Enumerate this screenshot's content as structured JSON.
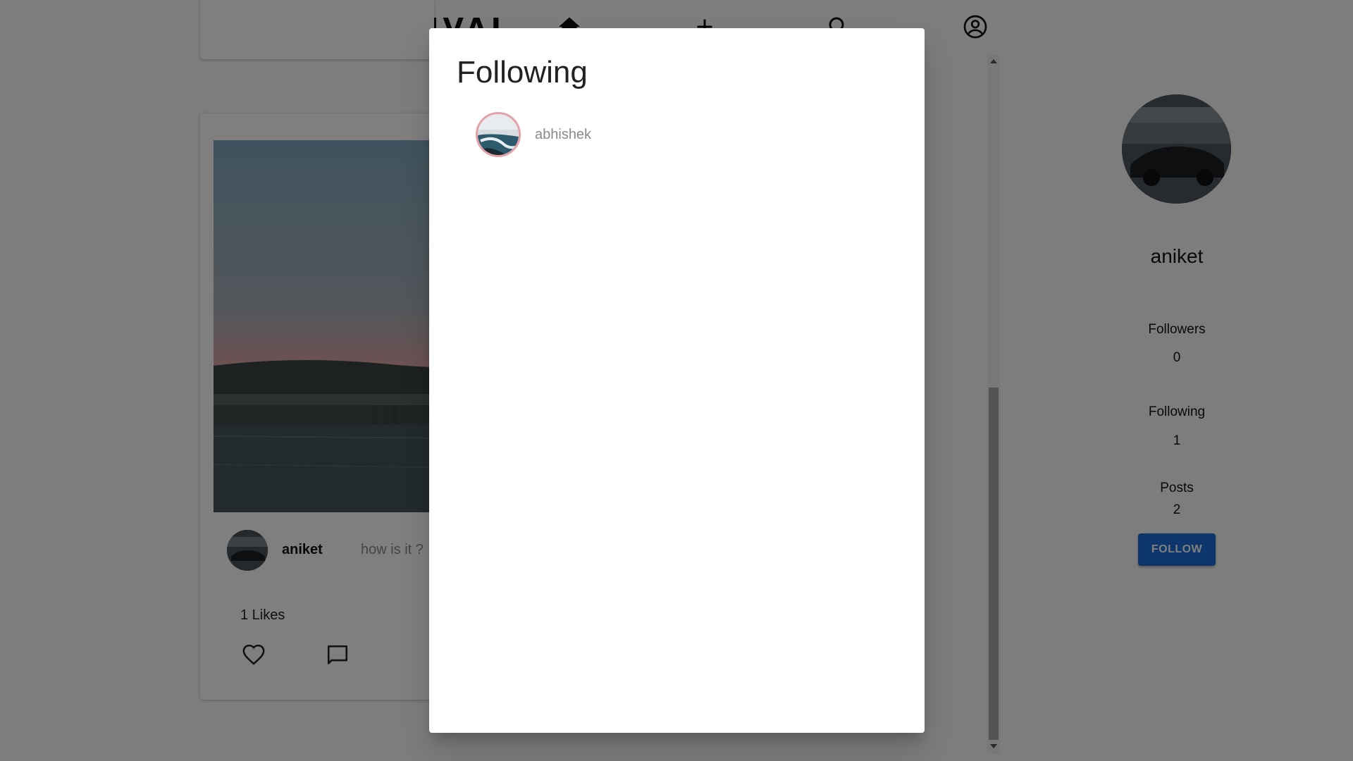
{
  "nav": {
    "logo": "CARNIVAL",
    "icons": [
      "home-icon",
      "add-icon",
      "search-icon",
      "account-circle-icon"
    ]
  },
  "post": {
    "author": "aniket",
    "caption": "how is it ?",
    "likes_text": "1 Likes",
    "icons": [
      "heart-outline-icon",
      "comment-icon"
    ]
  },
  "profile": {
    "username": "aniket",
    "followers_label": "Followers",
    "followers_count": "0",
    "following_label": "Following",
    "following_count": "1",
    "posts_label": "Posts",
    "posts_count": "2",
    "follow_button": "FOLLOW"
  },
  "dialog": {
    "title": "Following",
    "items": [
      {
        "username": "abhishek"
      }
    ]
  },
  "colors": {
    "accent": "#1a6dd8",
    "overlay": "rgba(0,0,0,0.5)",
    "avatar_ring": "#e6a1a8"
  }
}
